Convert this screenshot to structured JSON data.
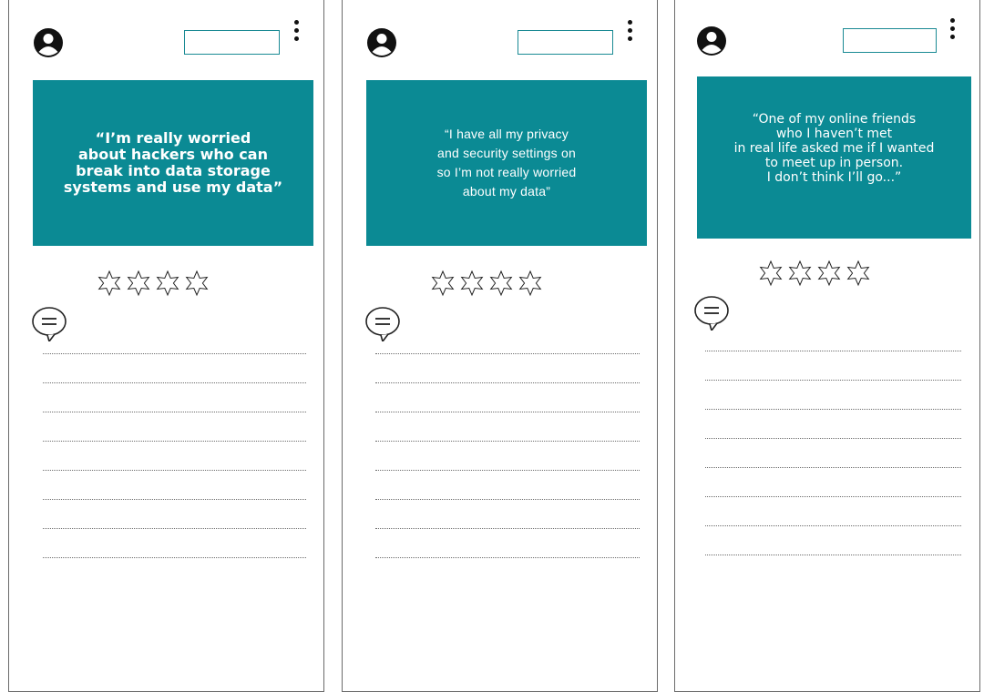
{
  "screens": [
    {
      "quote": "“I’m really worried\nabout hackers who can\nbreak into data storage\nsystems and use my data”",
      "rating_stars": 4,
      "rating_value": 0,
      "search_value": ""
    },
    {
      "quote": "“I have all my privacy\nand security settings on\nso I’m not really worried\nabout my data”",
      "rating_stars": 4,
      "rating_value": 0,
      "search_value": ""
    },
    {
      "quote": "“One of my online friends\nwho I haven’t met\nin real life asked me if I wanted\nto meet up in person.\nI don’t think I’ll go...”",
      "rating_stars": 4,
      "rating_value": 0,
      "search_value": ""
    }
  ],
  "icons": {
    "profile": "user-profile-icon",
    "menu": "more-vertical-icon",
    "star": "star-outline-icon",
    "comment": "speech-bubble-icon"
  },
  "colors": {
    "accent": "#0b8a94",
    "quote_text": "#ffffff",
    "outline": "#1a8a94",
    "frame": "#6b6b6b"
  }
}
